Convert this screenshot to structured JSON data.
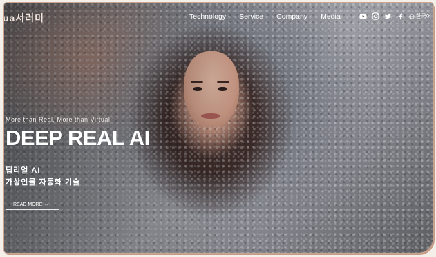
{
  "brand": {
    "logo_text": "ua서러미"
  },
  "nav": {
    "items": [
      {
        "label": "Technology"
      },
      {
        "label": "Service"
      },
      {
        "label": "Company"
      },
      {
        "label": "Media"
      }
    ],
    "social_icons": [
      "youtube-icon",
      "instagram-icon",
      "twitter-icon",
      "facebook-icon"
    ],
    "language_label": "한국어"
  },
  "hero": {
    "tagline": "More than Real, More than Virtual",
    "headline": "DEEP REAL AI",
    "subline_1": "딥리얼 AI",
    "subline_2": "가상인물 자동화 기술",
    "cta_label": "READ MORE →"
  },
  "colors": {
    "accent_border": "#c59a86",
    "text": "#ffffff"
  }
}
